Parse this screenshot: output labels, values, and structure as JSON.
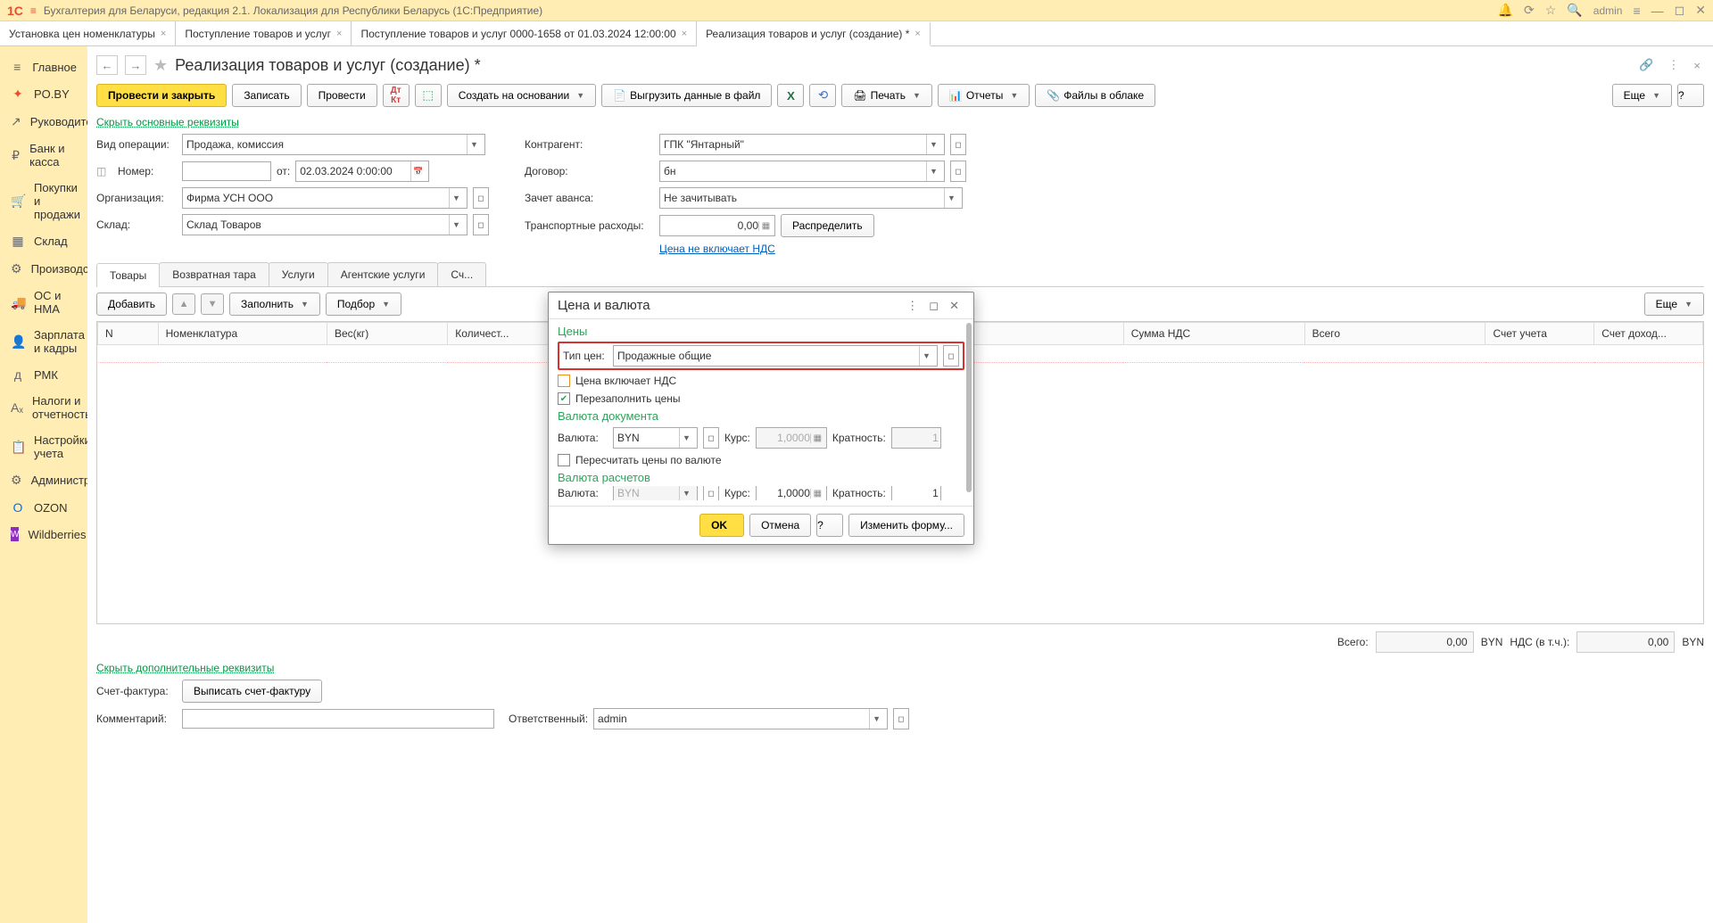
{
  "titlebar": {
    "logo": "1C",
    "title": "Бухгалтерия для Беларуси, редакция 2.1. Локализация для Республики Беларусь   (1С:Предприятие)",
    "user": "admin"
  },
  "tabs": [
    {
      "label": "Установка цен номенклатуры"
    },
    {
      "label": "Поступление товаров и услуг"
    },
    {
      "label": "Поступление товаров и услуг 0000-1658 от 01.03.2024 12:00:00"
    },
    {
      "label": "Реализация товаров и услуг (создание) *",
      "active": true
    }
  ],
  "sidebar": [
    {
      "icon": "≡",
      "label": "Главное"
    },
    {
      "icon": "✦",
      "label": "PO.BY",
      "cls": "red"
    },
    {
      "icon": "↗",
      "label": "Руководителю"
    },
    {
      "icon": "₽",
      "label": "Банк и касса"
    },
    {
      "icon": "🛒",
      "label": "Покупки и продажи"
    },
    {
      "icon": "▦",
      "label": "Склад"
    },
    {
      "icon": "⚙",
      "label": "Производство"
    },
    {
      "icon": "🚚",
      "label": "ОС и НМА"
    },
    {
      "icon": "👤",
      "label": "Зарплата и кадры"
    },
    {
      "icon": "д",
      "label": "РМК"
    },
    {
      "icon": "Aₓ",
      "label": "Налоги и отчетность"
    },
    {
      "icon": "📋",
      "label": "Настройки учета"
    },
    {
      "icon": "⚙",
      "label": "Администрирование"
    },
    {
      "icon": "O",
      "label": "OZON",
      "cls": "blue"
    },
    {
      "icon": "W",
      "label": "Wildberries"
    }
  ],
  "page": {
    "title": "Реализация товаров и услуг (создание) *",
    "toolbar": {
      "post_close": "Провести и закрыть",
      "save": "Записать",
      "post": "Провести",
      "create_based": "Создать на основании",
      "export_file": "Выгрузить данные в файл",
      "print": "Печать",
      "reports": "Отчеты",
      "cloud_files": "Файлы в облаке",
      "more": "Еще"
    },
    "hide_main": "Скрыть основные реквизиты",
    "fields": {
      "op_type_label": "Вид операции:",
      "op_type": "Продажа, комиссия",
      "number_label": "Номер:",
      "number": "",
      "from": "от:",
      "date": "02.03.2024  0:00:00",
      "org_label": "Организация:",
      "org": "Фирма УСН ООО",
      "warehouse_label": "Склад:",
      "warehouse": "Склад Товаров",
      "counterparty_label": "Контрагент:",
      "counterparty": "ГПК \"Янтарный\"",
      "contract_label": "Договор:",
      "contract": "бн",
      "advance_label": "Зачет аванса:",
      "advance": "Не зачитывать",
      "transport_label": "Транспортные расходы:",
      "transport_amount": "0,00",
      "distribute": "Распределить",
      "vat_link": "Цена не включает НДС"
    },
    "inner_tabs": [
      "Товары",
      "Возвратная тара",
      "Услуги",
      "Агентские услуги",
      "Сч..."
    ],
    "subtoolbar": {
      "add": "Добавить",
      "fill": "Заполнить",
      "pick": "Подбор",
      "more": "Еще"
    },
    "columns": [
      "N",
      "Номенклатура",
      "Вес(кг)",
      "Количест...",
      "",
      "",
      "",
      "Сумма НДС",
      "Всего",
      "Счет учета",
      "Счет доход..."
    ],
    "totals": {
      "total_label": "Всего:",
      "total": "0,00",
      "cur1": "BYN",
      "vat_label": "НДС (в т.ч.):",
      "vat": "0,00",
      "cur2": "BYN"
    },
    "hide_extra": "Скрыть дополнительные реквизиты",
    "invoice_label": "Счет-фактура:",
    "invoice_btn": "Выписать счет-фактуру",
    "comment_label": "Комментарий:",
    "comment": "",
    "responsible_label": "Ответственный:",
    "responsible": "admin"
  },
  "modal": {
    "title": "Цена и валюта",
    "section_prices": "Цены",
    "price_type_label": "Тип цен:",
    "price_type": "Продажные общие",
    "price_inc_vat": "Цена включает НДС",
    "refill": "Перезаполнить цены",
    "section_doc_currency": "Валюта документа",
    "currency_label": "Валюта:",
    "currency": "BYN",
    "rate_label": "Курс:",
    "rate": "1,0000",
    "mult_label": "Кратность:",
    "mult": "1",
    "recalc_currency": "Пересчитать цены по валюте",
    "section_calc_currency": "Валюта расчетов",
    "currency2": "BYN",
    "rate2": "1,0000",
    "mult2": "1",
    "ok": "OK",
    "cancel": "Отмена",
    "change_form": "Изменить форму..."
  }
}
